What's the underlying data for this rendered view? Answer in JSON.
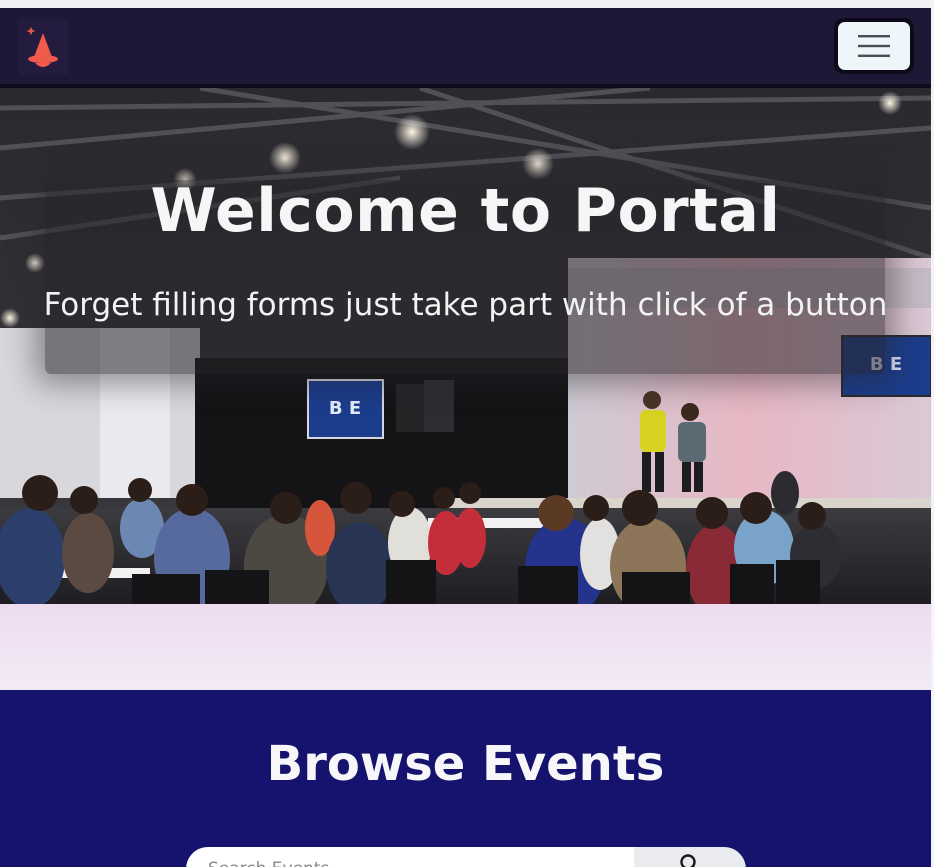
{
  "navbar": {
    "logo_icon": "wizard-hat-icon",
    "menu_icon": "hamburger-icon",
    "background": "#1c1836",
    "logo_color": "#f05a4a"
  },
  "hero": {
    "title": "Welcome to Portal",
    "subtitle": "Forget filling forms just take part with click of a button"
  },
  "browse": {
    "title": "Browse Events",
    "background": "#16136f",
    "search_placeholder": "Search Events",
    "search_icon": "search-icon"
  }
}
